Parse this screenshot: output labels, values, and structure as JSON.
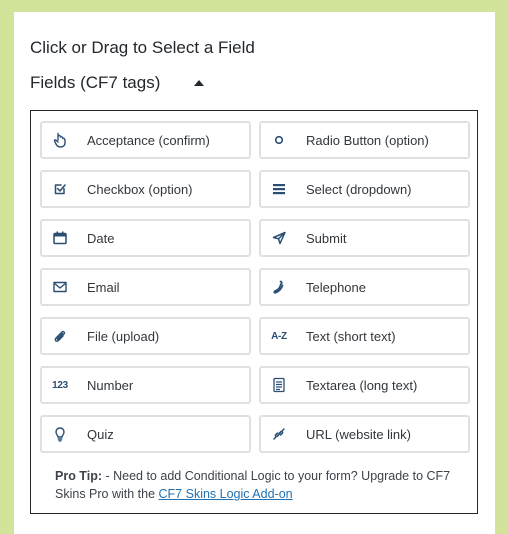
{
  "panel": {
    "title": "Click or Drag to Select a Field",
    "section_label": "Fields (CF7 tags)"
  },
  "fields": [
    {
      "label": "Acceptance (confirm)",
      "icon": "hand-icon"
    },
    {
      "label": "Radio Button (option)",
      "icon": "radio-icon"
    },
    {
      "label": "Checkbox (option)",
      "icon": "checkbox-icon"
    },
    {
      "label": "Select (dropdown)",
      "icon": "list-icon"
    },
    {
      "label": "Date",
      "icon": "calendar-icon"
    },
    {
      "label": "Submit",
      "icon": "send-icon"
    },
    {
      "label": "Email",
      "icon": "envelope-icon"
    },
    {
      "label": "Telephone",
      "icon": "phone-icon"
    },
    {
      "label": "File (upload)",
      "icon": "paperclip-icon"
    },
    {
      "label": "Text (short text)",
      "icon": "a-z-icon",
      "icon_text": "A-Z"
    },
    {
      "label": "Number",
      "icon": "numbers-icon",
      "icon_text": "123"
    },
    {
      "label": "Textarea (long text)",
      "icon": "textarea-icon"
    },
    {
      "label": "Quiz",
      "icon": "lightbulb-icon"
    },
    {
      "label": "URL (website link)",
      "icon": "link-icon"
    }
  ],
  "protip": {
    "label": "Pro Tip:",
    "text": " - Need to add Conditional Logic to your form? Upgrade to CF7 Skins Pro with the ",
    "link_text": "CF7 Skins Logic Add-on"
  },
  "colors": {
    "background": "#d2e39a",
    "panel": "#ffffff",
    "icon": "#2b4f74",
    "link": "#2271b1"
  }
}
